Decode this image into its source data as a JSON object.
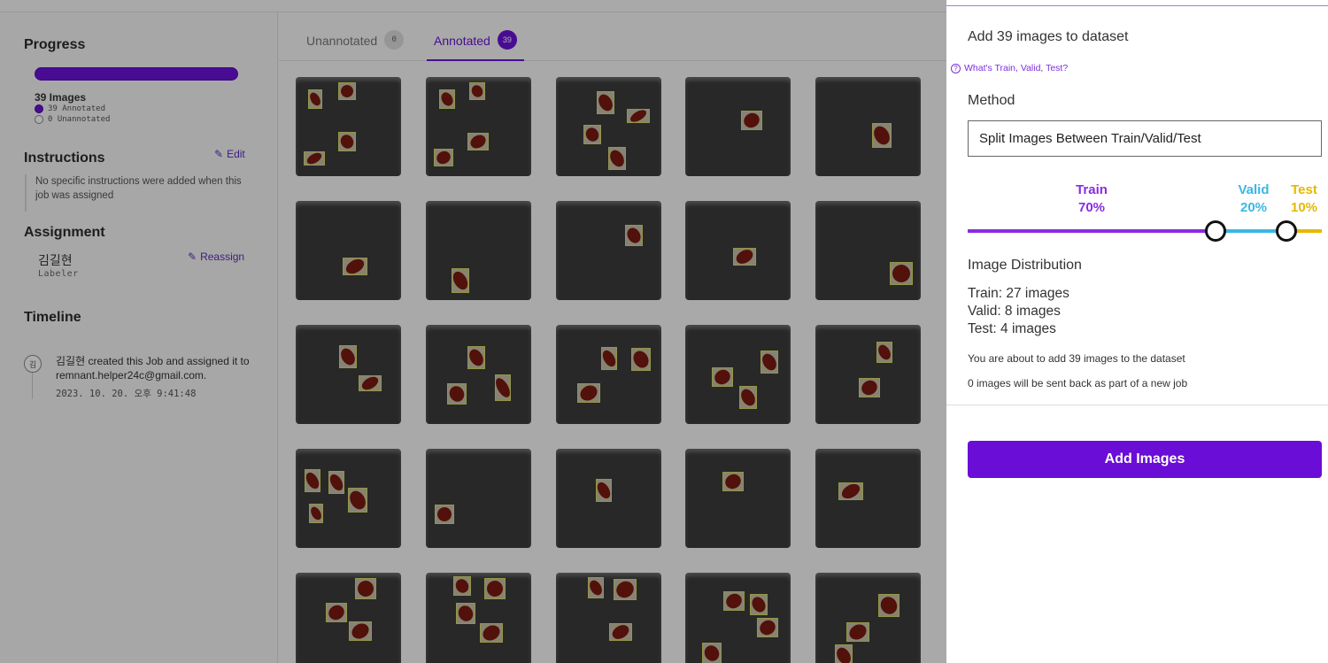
{
  "sidebar": {
    "progress_title": "Progress",
    "images_count": "39 Images",
    "annotated_legend": "39 Annotated",
    "unannotated_legend": "0 Unannotated",
    "instructions_title": "Instructions",
    "edit_label": "Edit",
    "instructions_text": "No specific instructions were added when this job was assigned",
    "assignment_title": "Assignment",
    "reassign_label": "Reassign",
    "assignee_name": "김길현",
    "assignee_role": "Labeler",
    "timeline_title": "Timeline",
    "timeline_avatar": "김",
    "timeline_text": "김길현 created this Job and assigned it to remnant.helper24c@gmail.com.",
    "timeline_time": "2023. 10. 20. 오후 9:41:48"
  },
  "tabs": {
    "unannotated_label": "Unannotated",
    "unannotated_count": "0",
    "annotated_label": "Annotated",
    "annotated_count": "39"
  },
  "panel": {
    "title": "Add 39 images to dataset",
    "help_link": "What's Train, Valid, Test?",
    "method_label": "Method",
    "method_value": "Split Images Between Train/Valid/Test",
    "train_label": "Train",
    "train_pct": "70%",
    "valid_label": "Valid",
    "valid_pct": "20%",
    "test_label": "Test",
    "test_pct": "10%",
    "split_values": {
      "train": 70,
      "valid": 20,
      "test": 10
    },
    "distribution_title": "Image Distribution",
    "train_dist": "Train: 27 images",
    "valid_dist": "Valid: 8 images",
    "test_dist": "Test: 4 images",
    "note_add": "You are about to add 39 images to the dataset",
    "note_back": "0 images will be sent back as part of a new job",
    "add_button": "Add Images"
  },
  "colors": {
    "accent": "#6a0dd6",
    "train": "#8a2be2",
    "valid": "#3ab7e6",
    "test": "#e6b800"
  }
}
